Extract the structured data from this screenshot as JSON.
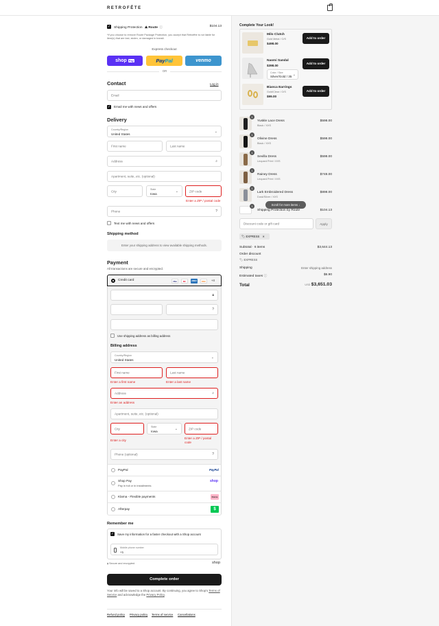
{
  "brand": "RETROFÊTE",
  "left": {
    "shipping_protection": {
      "label": "Shipping Protection",
      "route": "Route",
      "price": "$104.13",
      "note": "*If you choose to remove Route Package Protection, you accept that Retrofête is not liable for item(s) that are lost, stolen, or damaged in transit."
    },
    "express": {
      "title": "Express checkout",
      "shop_pay": "shop",
      "shop_pay_badge": "Pay",
      "paypal_a": "Pay",
      "paypal_b": "Pal",
      "venmo": "venmo",
      "or": "OR"
    },
    "contact": {
      "title": "Contact",
      "login": "Log in",
      "email_placeholder": "Email",
      "news_label": "Email me with news and offers"
    },
    "delivery": {
      "title": "Delivery",
      "country_label": "Country/Region",
      "country_value": "United States",
      "first_name": "First name",
      "last_name": "Last name",
      "address": "Address",
      "apartment": "Apartment, suite, etc. (optional)",
      "city": "City",
      "state_label": "State",
      "state_value": "Iowa",
      "zip": "ZIP code",
      "zip_error": "Enter a ZIP / postal code",
      "phone": "Phone",
      "text_news": "Text me with news and offers"
    },
    "shipping_method": {
      "title": "Shipping method",
      "message": "Enter your shipping address to view available shipping methods."
    },
    "payment": {
      "title": "Payment",
      "subtitle": "All transactions are secure and encrypted.",
      "credit_card": "Credit card",
      "more_cards": "+4",
      "card_badges": [
        "VISA",
        "MC",
        "AMEX",
        "DISC"
      ],
      "use_shipping": "Use shipping address as billing address",
      "billing_title": "Billing address",
      "billing_country_label": "Country/Region",
      "billing_country_value": "United States",
      "first_name": "First name",
      "first_name_error": "Enter a first name",
      "last_name": "Last name",
      "last_name_error": "Enter a last name",
      "address": "Address",
      "address_error": "Enter an address",
      "apartment": "Apartment, suite, etc. (optional)",
      "city": "City",
      "city_error": "Enter a city",
      "state_label": "State",
      "state_value": "Iowa",
      "zip": "ZIP code",
      "zip_error_line1": "Enter a ZIP / postal",
      "zip_error_line2": "code",
      "phone_optional": "Phone (optional)",
      "paypal": "PayPal",
      "paypal_logo": "PayPal",
      "shop_pay": "Shop Pay",
      "shop_pay_sub": "Pay in full or in installments",
      "shop_logo": "shop",
      "klarna": "Klarna - Flexible payments",
      "klarna_logo": "Klarna",
      "afterpay": "Afterpay",
      "afterpay_logo": "$"
    },
    "remember": {
      "title": "Remember me",
      "save_label": "Save my information for a faster checkout with a Shop account",
      "mobile_label": "Mobile phone number",
      "mobile_prefix": "+1",
      "secure": "Secure and encrypted",
      "shop_logo": "shop"
    },
    "complete_order": "Complete order",
    "legal_1": "Your info will be saved to a Shop account. By continuing, you agree to Shop's",
    "legal_tos": "Terms of Service",
    "legal_2": "and acknowledge the",
    "legal_privacy": "Privacy Policy",
    "footer_links": [
      "Refund policy",
      "Privacy policy",
      "Terms of service",
      "Cancellations"
    ]
  },
  "right": {
    "upsell": {
      "title": "Complete Your Look!",
      "items": [
        {
          "name": "Milo Clutch",
          "variant": "Gold Metal / O/S",
          "price": "$498.00",
          "button": "Add to order"
        },
        {
          "name": "Naomi Sandal",
          "price": "$398.00",
          "select_label": "Color / Size",
          "select_value": "Silver/Gold / 35",
          "button": "Add to order"
        },
        {
          "name": "Bianca Earrings",
          "variant": "Gold/Clear / O/S",
          "price": "$99.00",
          "button": "Add to order"
        }
      ]
    },
    "cart": [
      {
        "qty": "1",
        "name": "Yuskle Lace Dress",
        "variant": "Black / XXS",
        "price": "$598.00"
      },
      {
        "qty": "1",
        "name": "Olivine Dress",
        "variant": "Black / XXS",
        "price": "$598.00"
      },
      {
        "qty": "1",
        "name": "Sevilla Dress",
        "variant": "Leopard Print / XXS",
        "price": "$598.00"
      },
      {
        "qty": "1",
        "name": "Rainey Dress",
        "variant": "Leopard Print / XXS",
        "price": "$748.00"
      },
      {
        "qty": "1",
        "name": "Lark Embroidered Dress",
        "variant": "Dusk/Silver / XXS",
        "price": "$898.00"
      },
      {
        "qty": "1",
        "name": "Shipping Protection by Route",
        "variant": "",
        "price": "$104.13"
      }
    ],
    "scroll_more": "Scroll for more items",
    "discount_placeholder": "Discount code or gift card",
    "apply": "Apply",
    "express_tag": "EXPRESS",
    "subtotal_label": "Subtotal · 6 items",
    "subtotal_value": "$3,644.13",
    "order_discount": "Order discount",
    "order_discount_tag": "EXPRESS",
    "shipping_label": "Shipping",
    "shipping_value": "Enter shipping address",
    "taxes_label": "Estimated taxes",
    "taxes_value": "$6.90",
    "total_label": "Total",
    "currency": "USD",
    "total_value": "$3,651.03"
  }
}
